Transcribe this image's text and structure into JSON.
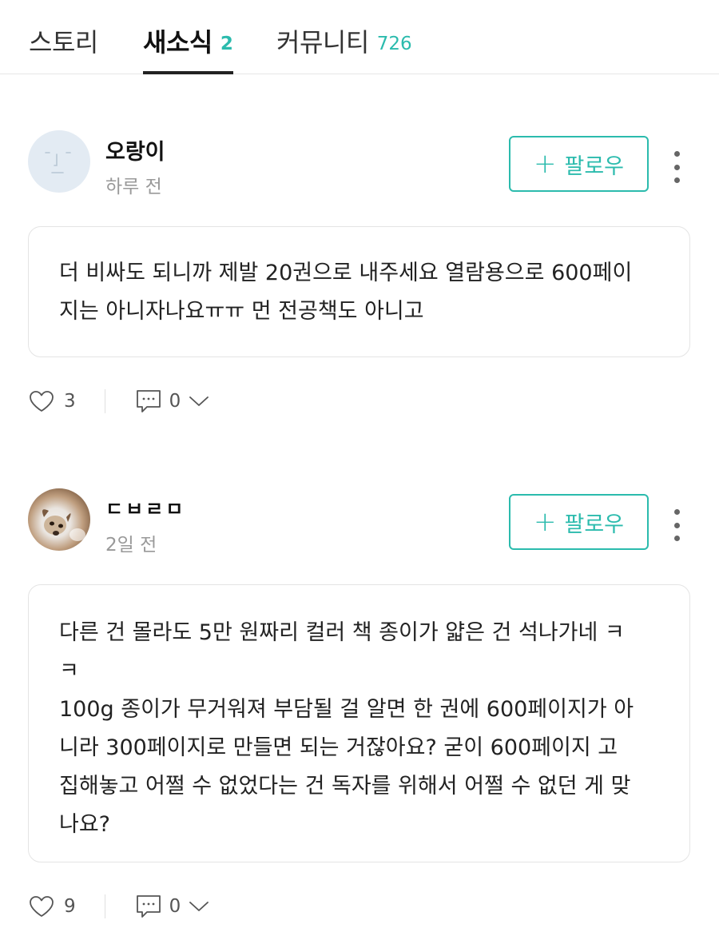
{
  "tabs": [
    {
      "label": "스토리",
      "count": ""
    },
    {
      "label": "새소식",
      "count": "2"
    },
    {
      "label": "커뮤니티",
      "count": "726"
    }
  ],
  "accent_color": "#2bbbad",
  "comments": [
    {
      "author": "오랑이",
      "time": "하루 전",
      "follow_label": "팔로우",
      "text": "더 비싸도 되니까 제발 20권으로 내주세요 열람용으로 600페이\n지는 아니자나요ㅠㅠ 먼 전공책도 아니고",
      "likes": "3",
      "replies": "0"
    },
    {
      "author": "ㄷㅂㄹㅁ",
      "time": "2일 전",
      "follow_label": "팔로우",
      "text": "다른 건 몰라도 5만 원짜리 컬러 책 종이가 얇은 건 석나가네 ㅋ\nㅋ\n100g 종이가 무거워져 부담될 걸 알면 한 권에 600페이지가 아\n니라 300페이지로 만들면 되는 거잖아요? 굳이 600페이지 고\n집해놓고 어쩔 수 없었다는 건 독자를 위해서 어쩔 수 없던 게 맞\n나요?",
      "likes": "9",
      "replies": "0"
    }
  ]
}
